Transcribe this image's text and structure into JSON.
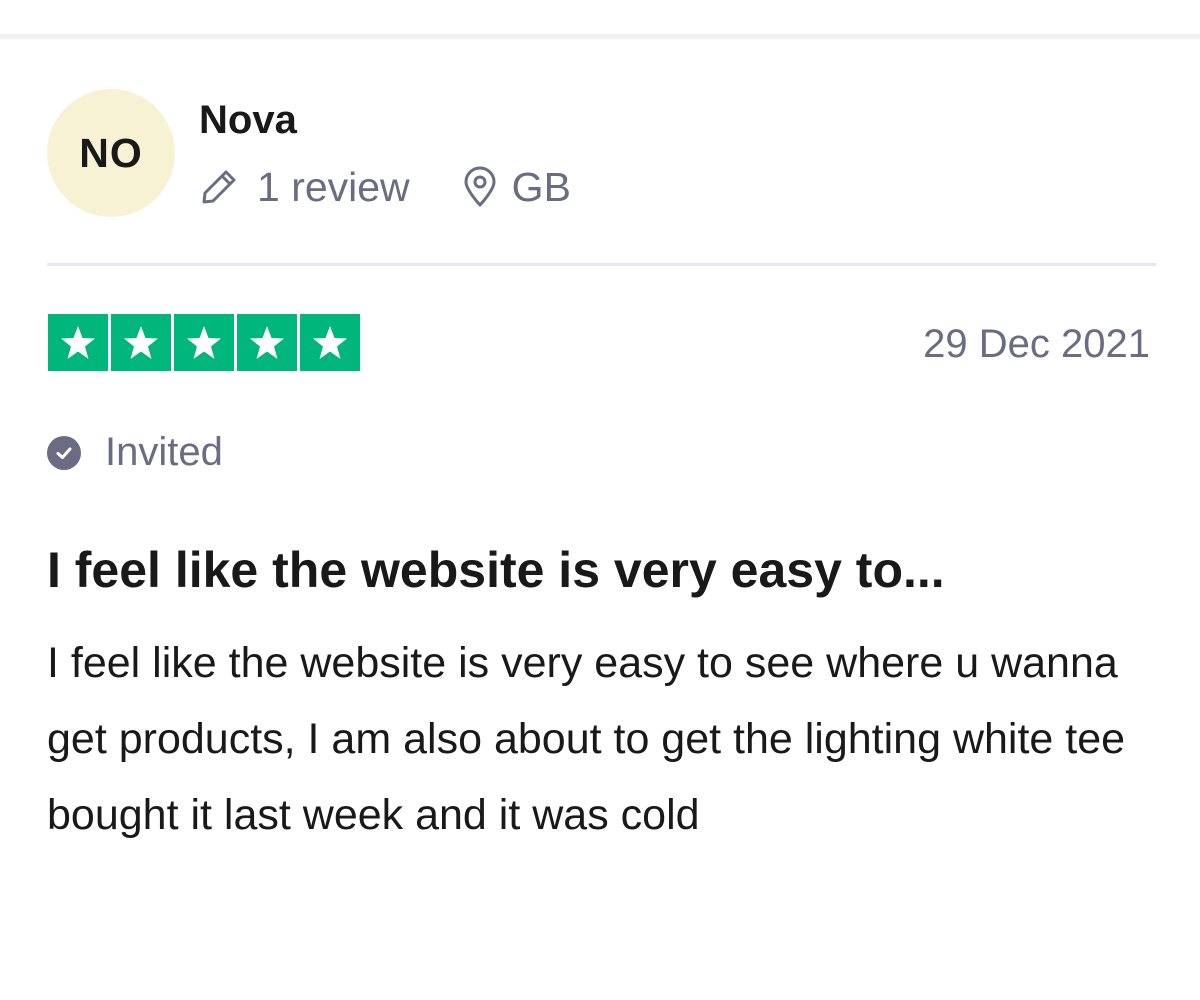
{
  "reviewer": {
    "initials": "NO",
    "name": "Nova",
    "review_count": "1 review",
    "country": "GB",
    "icons": {
      "review_count": "pencil-icon",
      "country": "location-pin-icon"
    },
    "avatar_color": "#f8f2d4"
  },
  "rating": {
    "stars": 5,
    "max_stars": 5,
    "color": "#00b67a",
    "date": "29 Dec 2021"
  },
  "badge": {
    "label": "Invited",
    "icon": "checkmark-circle-icon"
  },
  "review": {
    "title": "I feel like the website is very easy to...",
    "body": "I feel like the website is very easy to see where u wanna get products, I am also about to get the lighting white tee bought it last week and it was cold"
  },
  "colors": {
    "text": "#191919",
    "muted": "#6b6b84",
    "divider": "#e6e6ec"
  }
}
